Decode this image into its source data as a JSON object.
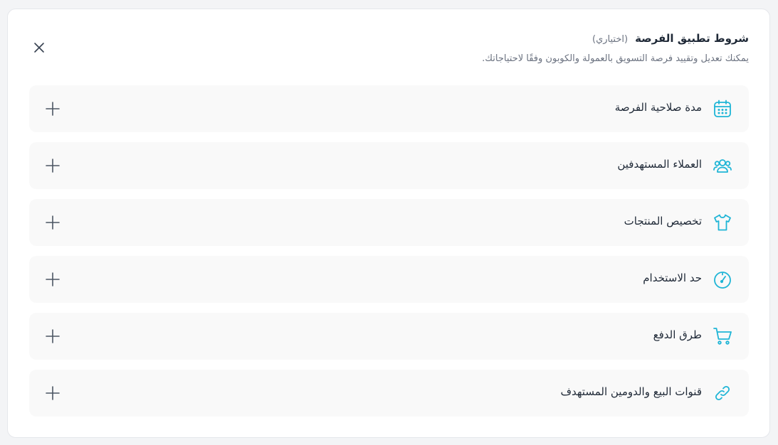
{
  "colors": {
    "accent": "#1fb5d6",
    "text": "#1f2937",
    "muted": "#6b7280",
    "rowBg": "#f9f9f9"
  },
  "header": {
    "title": "شروط تطبيق الفرصة",
    "optional": "(اختياري)",
    "subtitle": "يمكنك تعديل وتقييد فرصة التسويق بالعمولة والكوبون وفقًا لاحتياجاتك."
  },
  "close_icon": "close-icon",
  "rows": [
    {
      "label": "مدة صلاحية الفرصة",
      "icon": "calendar-icon"
    },
    {
      "label": "العملاء المستهدفين",
      "icon": "users-icon"
    },
    {
      "label": "تخصيص المنتجات",
      "icon": "tshirt-icon"
    },
    {
      "label": "حد الاستخدام",
      "icon": "gauge-icon"
    },
    {
      "label": "طرق الدفع",
      "icon": "cart-icon"
    },
    {
      "label": "قنوات البيع والدومين المستهدف",
      "icon": "link-icon"
    }
  ],
  "expand_icon": "plus-icon"
}
